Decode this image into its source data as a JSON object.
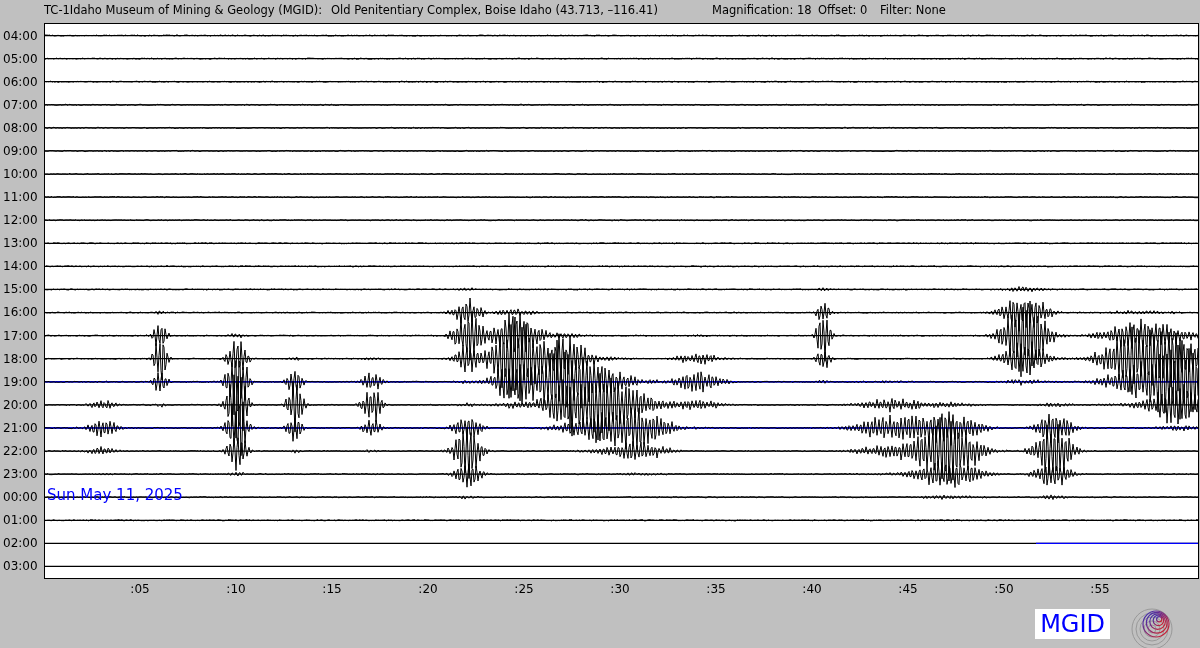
{
  "header": {
    "station": "TC-1Idaho Museum of Mining & Geology (MGID):",
    "location": "Old Penitentiary Complex, Boise Idaho (43.713, –116.41)",
    "magnification": "Magnification: 18",
    "offset": "Offset: 0",
    "filter": "Filter: None"
  },
  "hour_labels": [
    "04:00",
    "05:00",
    "06:00",
    "07:00",
    "08:00",
    "09:00",
    "10:00",
    "11:00",
    "12:00",
    "13:00",
    "14:00",
    "15:00",
    "16:00",
    "17:00",
    "18:00",
    "19:00",
    "20:00",
    "21:00",
    "22:00",
    "23:00",
    "00:00",
    "01:00",
    "02:00",
    "03:00"
  ],
  "minute_labels": [
    ":05",
    ":10",
    ":15",
    ":20",
    ":25",
    ":30",
    ":35",
    ":40",
    ":45",
    ":50",
    ":55"
  ],
  "date_label": "Sun May 11, 2025",
  "logo_text": "MGID"
}
